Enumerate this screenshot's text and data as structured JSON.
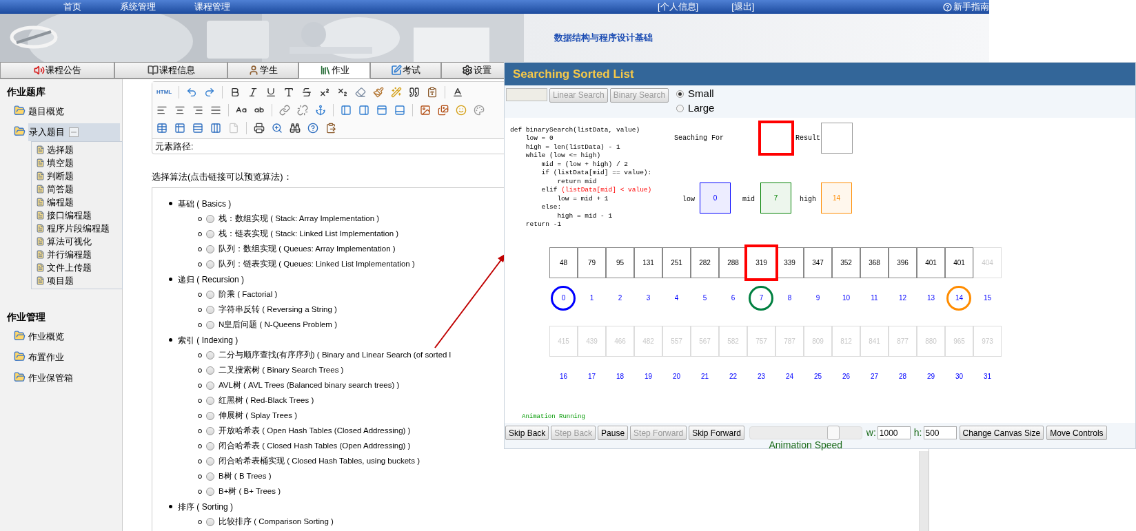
{
  "top_nav": {
    "items": [
      "首页",
      "系统管理",
      "课程管理"
    ],
    "user_links": [
      "[个人信息]",
      "[退出]"
    ],
    "help": "新手指南"
  },
  "header": {
    "course_title": "数据结构与程序设计基础"
  },
  "tabs": [
    {
      "label": "课程公告",
      "selected": false
    },
    {
      "label": "课程信息",
      "selected": false
    },
    {
      "label": "学生",
      "selected": false
    },
    {
      "label": "作业",
      "selected": true
    },
    {
      "label": "考试",
      "selected": false
    },
    {
      "label": "设置",
      "selected": false
    }
  ],
  "sidebar": {
    "sections": [
      {
        "title": "作业题库",
        "items": [
          {
            "label": "题目概览",
            "expanded": false
          },
          {
            "label": "录入题目",
            "expanded": true,
            "children": [
              "选择题",
              "填空题",
              "判断题",
              "简答题",
              "编程题",
              "接口编程题",
              "程序片段编程题",
              "算法可视化",
              "并行编程题",
              "文件上传题",
              "项目题"
            ]
          }
        ]
      },
      {
        "title": "作业管理",
        "items": [
          {
            "label": "作业概览",
            "expanded": false
          },
          {
            "label": "布置作业",
            "expanded": false
          },
          {
            "label": "作业保管箱",
            "expanded": false
          }
        ]
      }
    ]
  },
  "editor": {
    "source_button": "HTML",
    "element_path_label": "元素路径:"
  },
  "algorithm_picker": {
    "label": "选择算法(点击链接可以预览算法)：",
    "categories": [
      {
        "label": "基础 ( Basics )",
        "children": [
          {
            "label": "栈：数组实现 ( Stack: Array Implementation )",
            "selected": false
          },
          {
            "label": "栈：链表实现 ( Stack: Linked List Implementation )",
            "selected": false
          },
          {
            "label": "队列：数组实现 ( Queues: Array Implementation )",
            "selected": false
          },
          {
            "label": "队列：链表实现 ( Queues: Linked List Implementation )",
            "selected": false
          }
        ]
      },
      {
        "label": "递归 ( Recursion )",
        "children": [
          {
            "label": "阶乘 ( Factorial )",
            "selected": false
          },
          {
            "label": "字符串反转 ( Reversing a String )",
            "selected": false
          },
          {
            "label": "N皇后问题 ( N-Queens Problem )",
            "selected": false
          }
        ]
      },
      {
        "label": "索引 ( Indexing )",
        "children": [
          {
            "label": "二分与顺序查找(有序序列) ( Binary and Linear Search (of sorted l",
            "selected": false
          },
          {
            "label": "二叉搜索树 ( Binary Search Trees )",
            "selected": false
          },
          {
            "label": "AVL树 ( AVL Trees (Balanced binary search trees) )",
            "selected": false
          },
          {
            "label": "红黑树 ( Red-Black Trees )",
            "selected": false
          },
          {
            "label": "伸展树 ( Splay Trees )",
            "selected": false
          },
          {
            "label": "开放哈希表 ( Open Hash Tables (Closed Addressing) )",
            "selected": false
          },
          {
            "label": "闭合哈希表 ( Closed Hash Tables (Open Addressing) )",
            "selected": false
          },
          {
            "label": "闭合哈希表桶实现 ( Closed Hash Tables, using buckets )",
            "selected": false
          },
          {
            "label": "B树 ( B Trees )",
            "selected": false
          },
          {
            "label": "B+树 ( B+ Trees )",
            "selected": false
          }
        ]
      },
      {
        "label": "排序 ( Sorting )",
        "children": [
          {
            "label": "比较排序 ( Comparison Sorting )",
            "selected": false
          }
        ]
      }
    ]
  },
  "visualizer": {
    "title": "Searching Sorted List",
    "search_buttons": [
      {
        "label": "Linear Search",
        "disabled": true
      },
      {
        "label": "Binary Search",
        "disabled": true
      }
    ],
    "size_options": [
      {
        "label": "Small",
        "selected": true
      },
      {
        "label": "Large",
        "selected": false
      }
    ],
    "code": [
      [
        {
          "text": "def binarySearch(listData, value)",
          "highlighted": false
        }
      ],
      [
        {
          "text": "    low = 0",
          "highlighted": false
        }
      ],
      [
        {
          "text": "    high = len(listData) - 1",
          "highlighted": false
        }
      ],
      [
        {
          "text": "    while (low <= high)",
          "highlighted": false
        }
      ],
      [
        {
          "text": "        mid = (low + high) / 2",
          "highlighted": false
        }
      ],
      [
        {
          "text": "        if (listData[mid] == value):",
          "highlighted": false
        }
      ],
      [
        {
          "text": "            return mid",
          "highlighted": false
        }
      ],
      [
        {
          "text": "        elif ",
          "highlighted": false
        },
        {
          "text": "(listData[mid] < value)",
          "highlighted": true
        }
      ],
      [
        {
          "text": "            low = mid + 1",
          "highlighted": false
        }
      ],
      [
        {
          "text": "        else:",
          "highlighted": false
        }
      ],
      [
        {
          "text": "            high = mid - 1",
          "highlighted": false
        }
      ],
      [
        {
          "text": "    return -1",
          "highlighted": false
        }
      ]
    ],
    "search_for": {
      "label": "Seaching For",
      "active": true
    },
    "result": {
      "label": "Result"
    },
    "pointers": [
      {
        "label": "low",
        "value": "0",
        "color": "#0000ff"
      },
      {
        "label": "mid",
        "value": "7",
        "color": "#008000"
      },
      {
        "label": "high",
        "value": "14",
        "color": "#ff8c00"
      }
    ],
    "array_rows": [
      {
        "cells": [
          {
            "value": "48",
            "index": "0",
            "faded": false,
            "selected": false,
            "color": "#0000ff"
          },
          {
            "value": "79",
            "index": "1",
            "faded": false,
            "selected": false
          },
          {
            "value": "95",
            "index": "2",
            "faded": false,
            "selected": false
          },
          {
            "value": "131",
            "index": "3",
            "faded": false,
            "selected": false
          },
          {
            "value": "251",
            "index": "4",
            "faded": false,
            "selected": false
          },
          {
            "value": "282",
            "index": "5",
            "faded": false,
            "selected": false
          },
          {
            "value": "288",
            "index": "6",
            "faded": false,
            "selected": false
          },
          {
            "value": "319",
            "index": "7",
            "faded": false,
            "selected": true,
            "color": "#008040"
          },
          {
            "value": "339",
            "index": "8",
            "faded": false,
            "selected": false
          },
          {
            "value": "347",
            "index": "9",
            "faded": false,
            "selected": false
          },
          {
            "value": "352",
            "index": "10",
            "faded": false,
            "selected": false
          },
          {
            "value": "368",
            "index": "11",
            "faded": false,
            "selected": false
          },
          {
            "value": "396",
            "index": "12",
            "faded": false,
            "selected": false
          },
          {
            "value": "401",
            "index": "13",
            "faded": false,
            "selected": false
          },
          {
            "value": "401",
            "index": "14",
            "faded": false,
            "selected": false,
            "color": "#ff8c00"
          },
          {
            "value": "404",
            "index": "15",
            "faded": true,
            "selected": false
          }
        ]
      },
      {
        "cells": [
          {
            "value": "415",
            "index": "16",
            "faded": true,
            "selected": false
          },
          {
            "value": "439",
            "index": "17",
            "faded": true,
            "selected": false
          },
          {
            "value": "466",
            "index": "18",
            "faded": true,
            "selected": false
          },
          {
            "value": "482",
            "index": "19",
            "faded": true,
            "selected": false
          },
          {
            "value": "557",
            "index": "20",
            "faded": true,
            "selected": false
          },
          {
            "value": "567",
            "index": "21",
            "faded": true,
            "selected": false
          },
          {
            "value": "582",
            "index": "22",
            "faded": true,
            "selected": false
          },
          {
            "value": "757",
            "index": "23",
            "faded": true,
            "selected": false
          },
          {
            "value": "787",
            "index": "24",
            "faded": true,
            "selected": false
          },
          {
            "value": "809",
            "index": "25",
            "faded": true,
            "selected": false
          },
          {
            "value": "812",
            "index": "26",
            "faded": true,
            "selected": false
          },
          {
            "value": "841",
            "index": "27",
            "faded": true,
            "selected": false
          },
          {
            "value": "877",
            "index": "28",
            "faded": true,
            "selected": false
          },
          {
            "value": "880",
            "index": "29",
            "faded": true,
            "selected": false
          },
          {
            "value": "965",
            "index": "30",
            "faded": true,
            "selected": false
          },
          {
            "value": "973",
            "index": "31",
            "faded": true,
            "selected": false
          }
        ]
      }
    ],
    "status": "Animation Running",
    "playback_buttons": [
      {
        "label": "Skip Back",
        "disabled": false
      },
      {
        "label": "Step Back",
        "disabled": true
      },
      {
        "label": "Pause",
        "disabled": false
      },
      {
        "label": "Step Forward",
        "disabled": true
      },
      {
        "label": "Skip Forward",
        "disabled": false
      }
    ],
    "speed": {
      "label": "Animation Speed",
      "level": 0.75
    },
    "width_field": {
      "label": "w:",
      "value": "1000"
    },
    "height_field": {
      "label": "h:",
      "value": "500"
    },
    "canvas_buttons": [
      "Change Canvas Size",
      "Move Controls"
    ]
  }
}
